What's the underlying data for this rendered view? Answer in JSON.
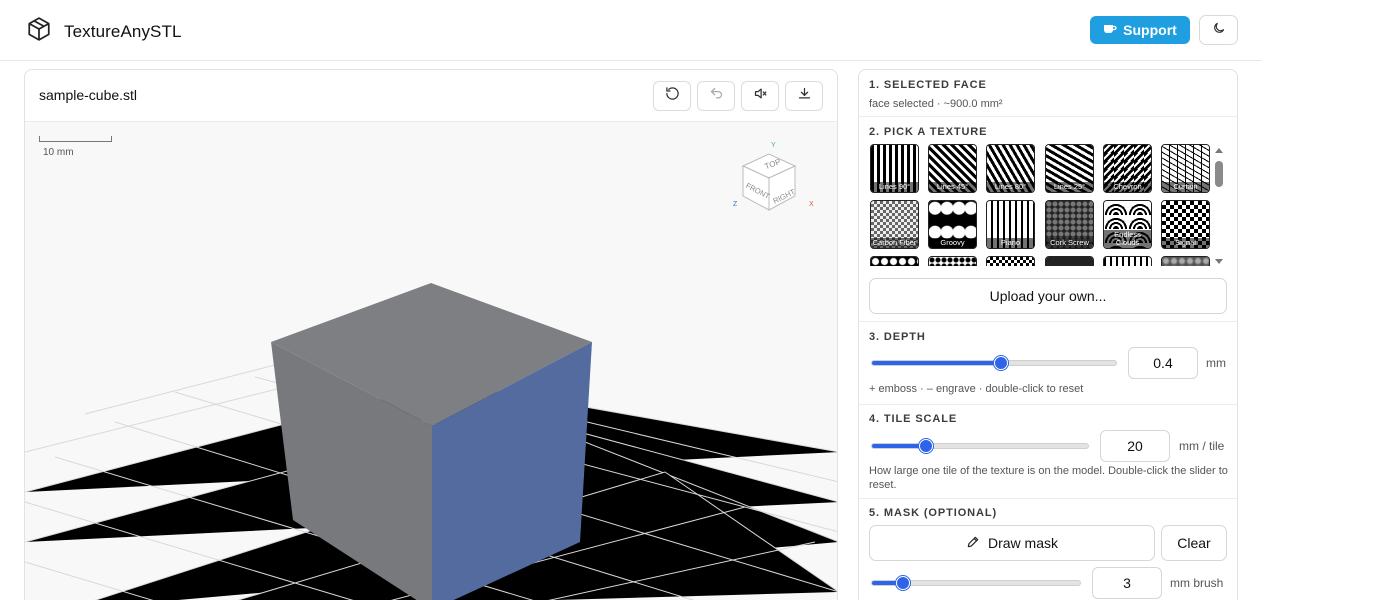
{
  "header": {
    "brand": "TextureAnySTL",
    "support_label": "Support"
  },
  "viewer": {
    "file_name": "sample-cube.stl",
    "scale_label": "10 mm",
    "view_cube": {
      "top": "TOP",
      "front": "FRONT",
      "right": "RIGHT",
      "axis_x": "X",
      "axis_y": "Y",
      "axis_z": "Z"
    }
  },
  "panel": {
    "selected": {
      "title": "1. SELECTED FACE",
      "info": "face selected · ~900.0 mm²"
    },
    "texture": {
      "title": "2. PICK A TEXTURE",
      "tiles": [
        "Lines 90°",
        "Lines 45°",
        "Lines 80°",
        "Lines 25°",
        "Chevron",
        "Curtain",
        "Carbon Fiber",
        "Groovy",
        "Piano",
        "Cork Screw",
        "Endless Clouds",
        "Signal"
      ],
      "upload_label": "Upload your own..."
    },
    "depth": {
      "title": "3. DEPTH",
      "value": "0.4",
      "unit": "mm",
      "slider_fraction": 0.53,
      "hint": "+ emboss · – engrave · double-click to reset"
    },
    "tile_scale": {
      "title": "4. TILE SCALE",
      "value": "20",
      "unit": "mm / tile",
      "slider_fraction": 0.25,
      "hint": "How large one tile of the texture is on the model. Double-click the slider to reset."
    },
    "mask": {
      "title": "5. MASK (OPTIONAL)",
      "draw_label": "Draw mask",
      "clear_label": "Clear",
      "brush_value": "3",
      "brush_unit": "mm brush",
      "slider_fraction": 0.15
    }
  },
  "colors": {
    "accent": "#2d64e8",
    "support": "#1f9fe0",
    "cube_face": "#7a7c7e",
    "cube_selected": "#536b9e"
  }
}
